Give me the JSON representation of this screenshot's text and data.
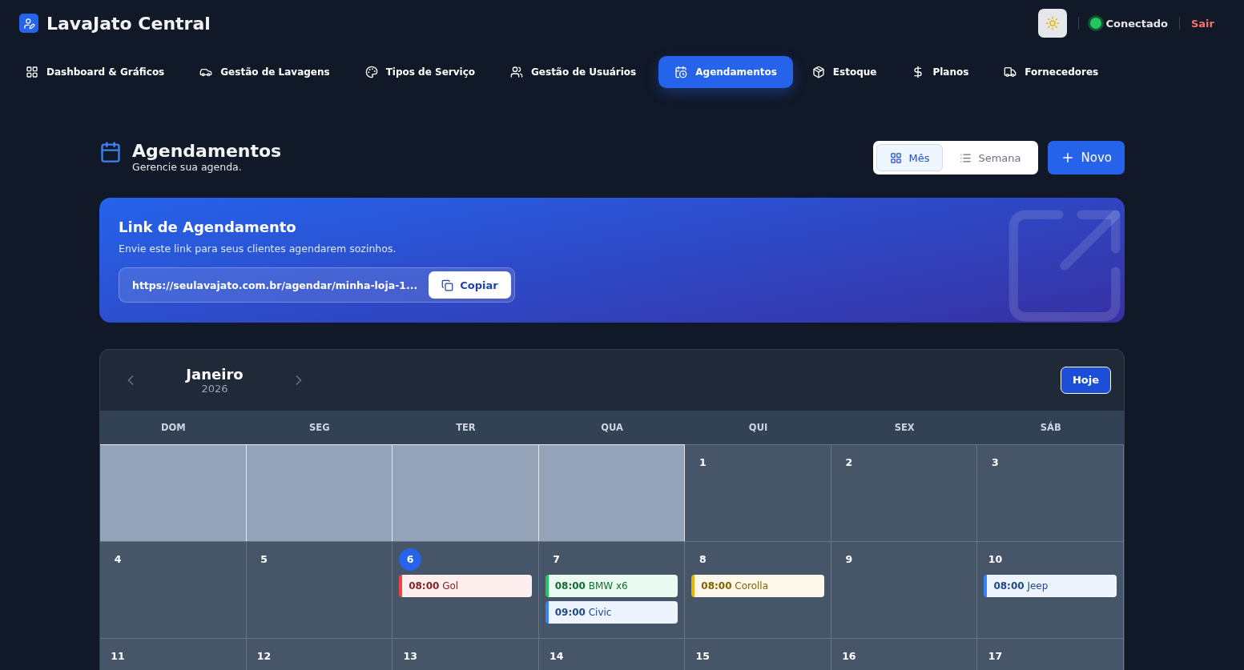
{
  "app": {
    "title": "LavaJato Central"
  },
  "status": {
    "connected": true,
    "label": "Conectado",
    "logout": "Sair"
  },
  "nav": [
    {
      "label": "Dashboard & Gráficos",
      "selected": false
    },
    {
      "label": "Gestão de Lavagens",
      "selected": false
    },
    {
      "label": "Tipos de Serviço",
      "selected": false
    },
    {
      "label": "Gestão de Usuários",
      "selected": false
    },
    {
      "label": "Agendamentos",
      "selected": true
    },
    {
      "label": "Estoque",
      "selected": false
    },
    {
      "label": "Planos",
      "selected": false
    },
    {
      "label": "Fornecedores",
      "selected": false
    }
  ],
  "page": {
    "title": "Agendamentos",
    "subtitle": "Gerencie sua agenda."
  },
  "view_toggle": [
    {
      "label": "Mês",
      "selected": true
    },
    {
      "label": "Semana",
      "selected": false
    }
  ],
  "new_button": "Novo",
  "link_card": {
    "title": "Link de Agendamento",
    "description": "Envie este link para seus clientes agendarem sozinhos.",
    "url": "https://seulavajato.com.br/agendar/minha-loja-1...",
    "copy": "Copiar"
  },
  "calendar": {
    "month": "Janeiro",
    "year": "2026",
    "today_button": "Hoje",
    "weekdays": [
      "DOM",
      "SEG",
      "TER",
      "QUA",
      "QUI",
      "SEX",
      "SÁB"
    ],
    "weeks": [
      [
        {
          "kind": "empty"
        },
        {
          "kind": "empty"
        },
        {
          "kind": "empty"
        },
        {
          "kind": "empty"
        },
        {
          "kind": "day",
          "day": "1",
          "today": false
        },
        {
          "kind": "day",
          "day": "2",
          "today": false
        },
        {
          "kind": "day",
          "day": "3",
          "today": false
        }
      ],
      [
        {
          "kind": "day",
          "day": "4",
          "today": false
        },
        {
          "kind": "day",
          "day": "5",
          "today": false
        },
        {
          "kind": "day",
          "day": "6",
          "today": true,
          "events": [
            {
              "text": "**08:00** Gol",
              "color": "#ef4444"
            }
          ]
        },
        {
          "kind": "day",
          "day": "7",
          "today": false,
          "events": [
            {
              "text": "**08:00** BMW x6",
              "color": "#22c55e"
            },
            {
              "text": "**09:00** Civic",
              "color": "#3b82f6"
            }
          ]
        },
        {
          "kind": "day",
          "day": "8",
          "today": false,
          "events": [
            {
              "text": "**08:00** Corolla",
              "color": "#eab308"
            }
          ]
        },
        {
          "kind": "day",
          "day": "9",
          "today": false
        },
        {
          "kind": "day",
          "day": "10",
          "today": false,
          "events": [
            {
              "text": "**08:00** Jeep",
              "color": "#3b82f6"
            }
          ]
        }
      ],
      [
        {
          "kind": "day",
          "day": "11",
          "today": false
        },
        {
          "kind": "day",
          "day": "12",
          "today": false
        },
        {
          "kind": "day",
          "day": "13",
          "today": false
        },
        {
          "kind": "day",
          "day": "14",
          "today": false
        },
        {
          "kind": "day",
          "day": "15",
          "today": false
        },
        {
          "kind": "day",
          "day": "16",
          "today": false
        },
        {
          "kind": "day",
          "day": "17",
          "today": false
        }
      ]
    ]
  }
}
